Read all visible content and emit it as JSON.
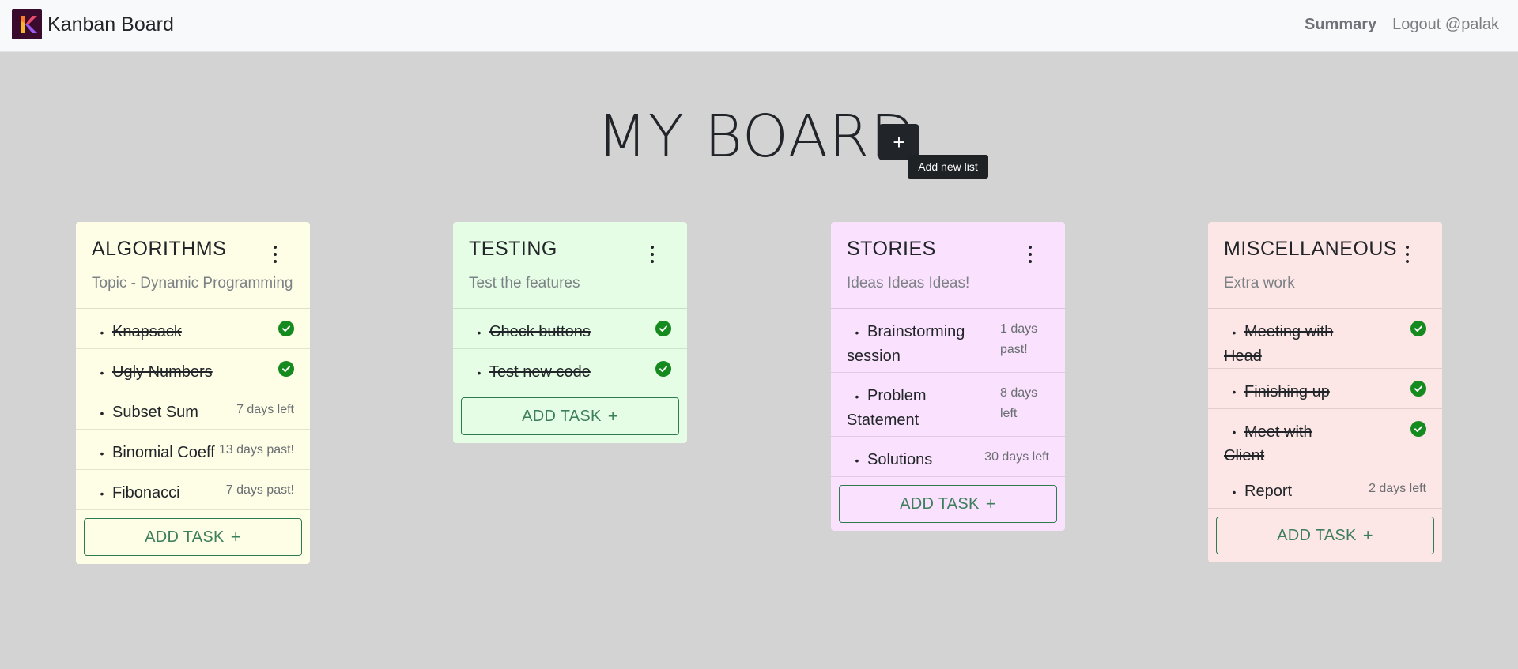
{
  "nav": {
    "brand": "Kanban Board",
    "summary": "Summary",
    "logout": "Logout @palak"
  },
  "board": {
    "title": "MY BOARD",
    "add_list_icon": "+",
    "add_list_tooltip": "Add new list"
  },
  "add_task_label": "ADD TASK",
  "add_task_icon": "+",
  "colors": {
    "algorithms": "#fefee7",
    "testing": "#e5fde5",
    "stories": "#fae1fd",
    "miscellaneous": "#fde6e6",
    "check": "#158a1e",
    "accent": "#2e7b52"
  },
  "lists": [
    {
      "title": "ALGORITHMS",
      "subtitle": "Topic - Dynamic Programming",
      "tasks": [
        {
          "name": "Knapsack",
          "done": true
        },
        {
          "name": "Ugly Numbers",
          "done": true
        },
        {
          "name": "Subset Sum",
          "due": "7 days left"
        },
        {
          "name": "Binomial Coeff",
          "due": "13 days past!"
        },
        {
          "name": "Fibonacci",
          "due": "7 days past!"
        }
      ]
    },
    {
      "title": "TESTING",
      "subtitle": "Test the features",
      "tasks": [
        {
          "name": "Check buttons",
          "done": true
        },
        {
          "name": "Test new code",
          "done": true
        }
      ]
    },
    {
      "title": "STORIES",
      "subtitle": "Ideas Ideas Ideas!",
      "tasks": [
        {
          "name": "Brainstorming session",
          "due": "1 days past!"
        },
        {
          "name": "Problem Statement",
          "due": "8 days left"
        },
        {
          "name": "Solutions",
          "due": "30 days left"
        }
      ]
    },
    {
      "title": "MISCELLANEOUS",
      "subtitle": "Extra work",
      "tasks": [
        {
          "name": "Meeting with Head",
          "done": true
        },
        {
          "name": "Finishing up",
          "done": true
        },
        {
          "name": "Meet with Client",
          "done": true
        },
        {
          "name": "Report",
          "due": "2 days left"
        }
      ]
    }
  ]
}
